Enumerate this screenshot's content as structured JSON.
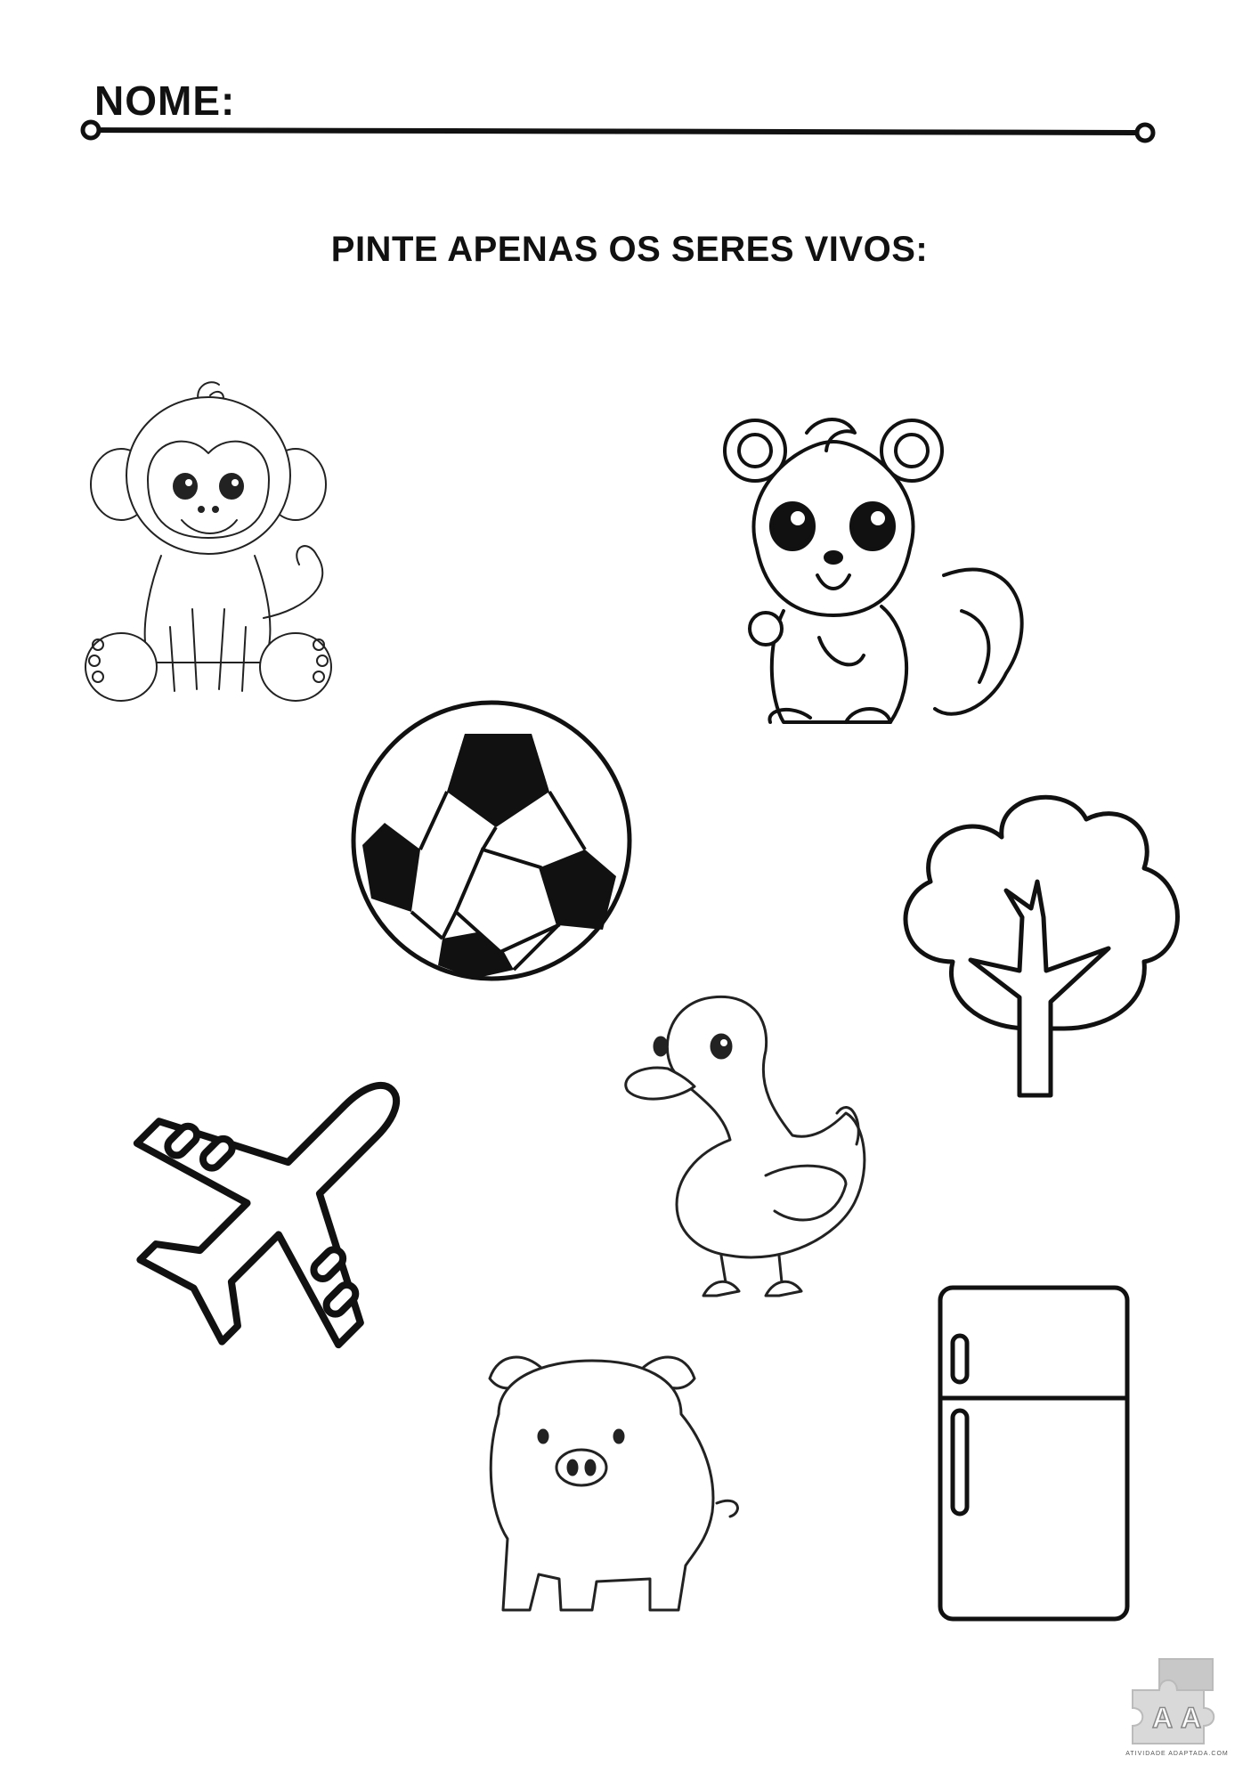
{
  "header": {
    "name_label": "NOME:"
  },
  "instruction": "PINTE APENAS OS SERES VIVOS:",
  "pictures": [
    {
      "icon": "monkey-icon"
    },
    {
      "icon": "squirrel-icon"
    },
    {
      "icon": "soccer-ball-icon"
    },
    {
      "icon": "tree-icon"
    },
    {
      "icon": "airplane-icon"
    },
    {
      "icon": "duck-icon"
    },
    {
      "icon": "pig-icon"
    },
    {
      "icon": "refrigerator-icon"
    }
  ],
  "logo": {
    "letters": "A A",
    "subtitle": "ATIVIDADE ADAPTADA.COM"
  }
}
